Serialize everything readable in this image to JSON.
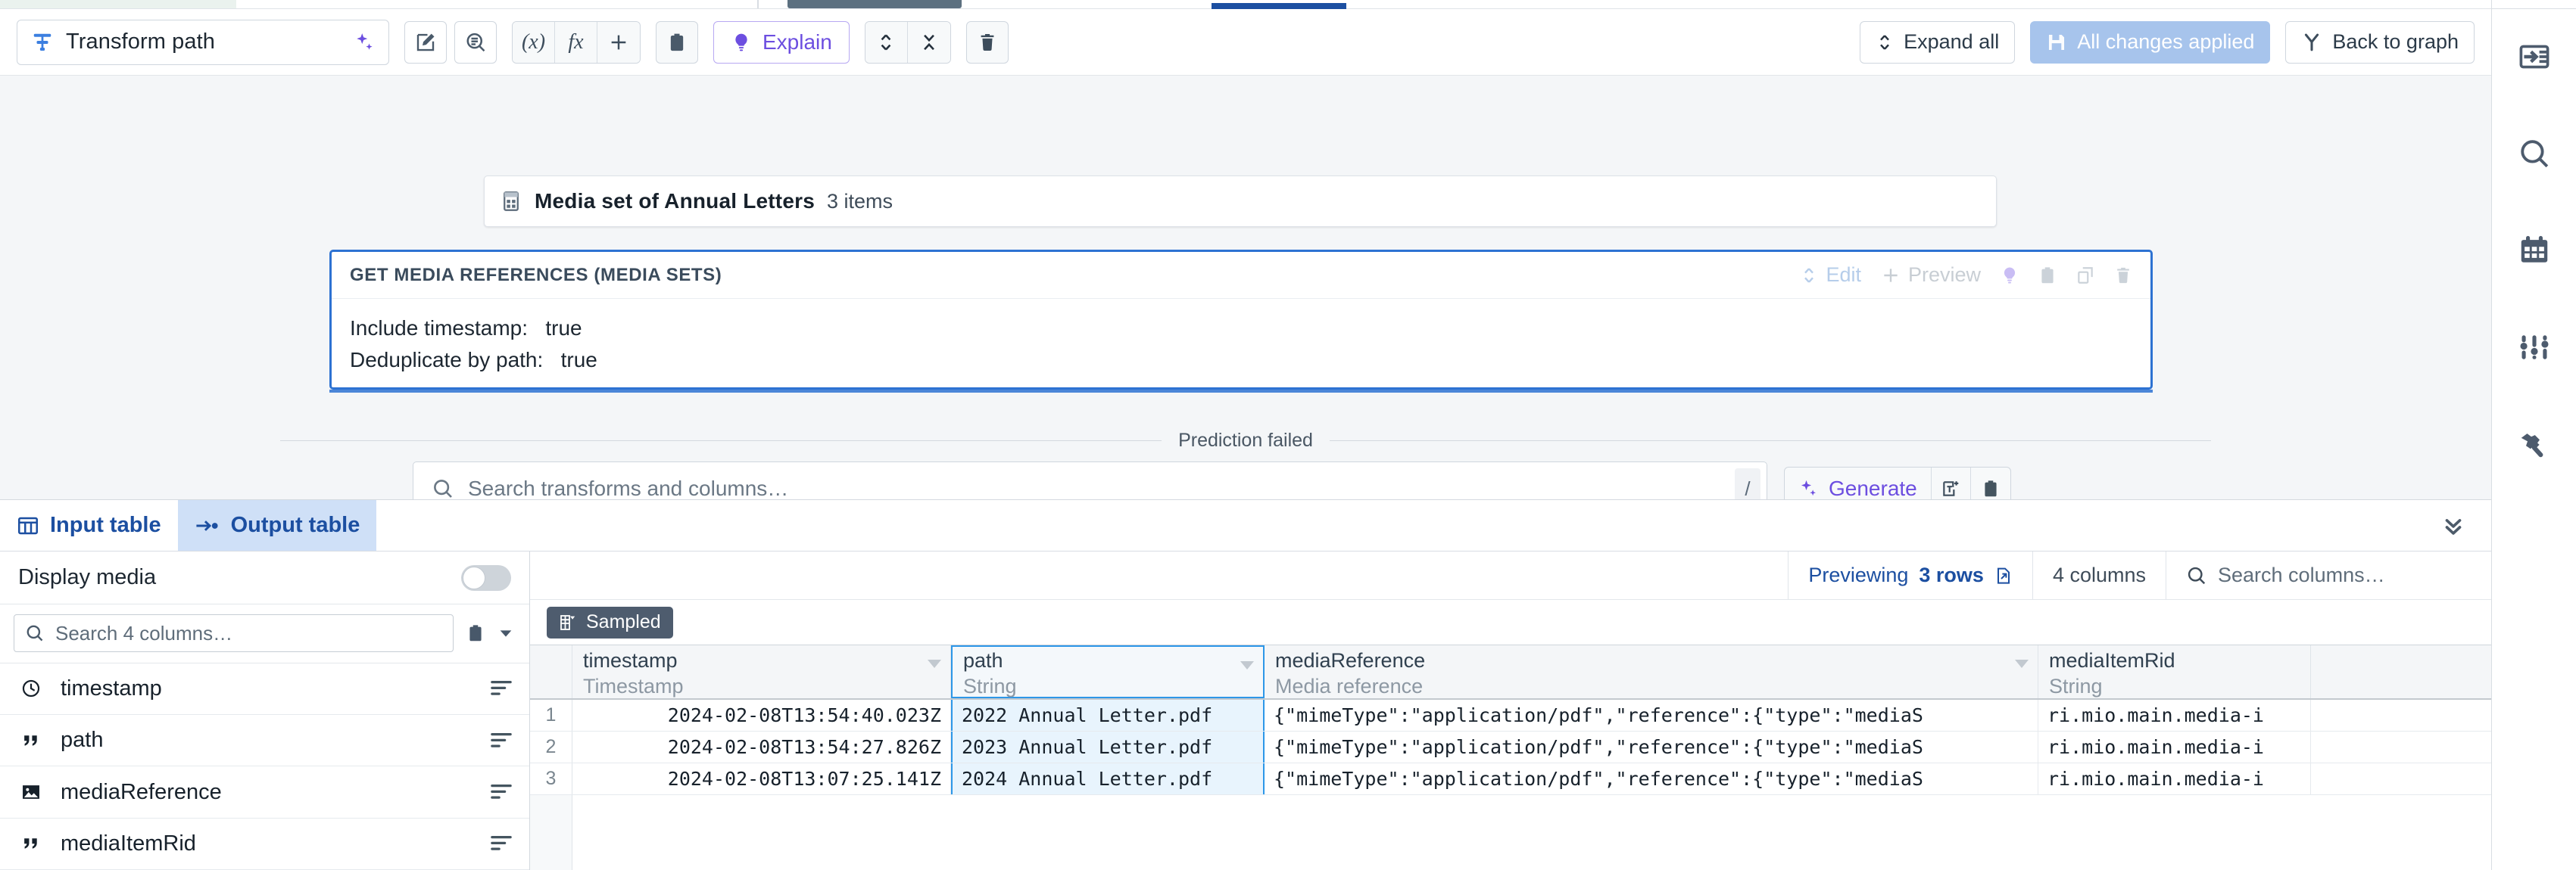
{
  "toolbar": {
    "transform_name": "Transform path",
    "sparkle_icon": "sparkles-icon",
    "buttons": [
      {
        "name": "edit-expression-button",
        "icon": "pencil-square-icon"
      },
      {
        "name": "search-transform-button",
        "icon": "zoom-document-icon"
      },
      {
        "name": "variable-button",
        "icon": "(x)"
      },
      {
        "name": "function-button",
        "icon": "fx"
      },
      {
        "name": "add-button",
        "icon": "plus-icon"
      },
      {
        "name": "paste-button",
        "icon": "clipboard-icon"
      }
    ],
    "explain_label": "Explain",
    "explain_icon": "lightbulb-icon",
    "move_icon": "expand-collapse-icon",
    "collapse_icon": "collapse-icon",
    "delete_icon": "trash-icon",
    "expand_all_label": "Expand all",
    "expand_all_icon": "chevron-up-down-icon",
    "changes_applied_label": "All changes applied",
    "changes_applied_icon": "save-icon",
    "back_to_graph_label": "Back to graph",
    "back_to_graph_icon": "branch-icon"
  },
  "canvas": {
    "mediaset": {
      "icon": "media-set-icon",
      "title": "Media set of Annual Letters",
      "count": "3 items"
    },
    "transform_card": {
      "title": "GET MEDIA REFERENCES (MEDIA SETS)",
      "params": [
        {
          "label": "Include timestamp:",
          "value": "true"
        },
        {
          "label": "Deduplicate by path:",
          "value": "true"
        }
      ],
      "actions": {
        "edit_label": "Edit",
        "edit_icon": "chevron-up-down-icon",
        "preview_label": "Preview",
        "preview_icon": "plus-icon",
        "bulb_icon": "lightbulb-icon",
        "clipboard_icon": "clipboard-icon",
        "duplicate_icon": "duplicate-icon",
        "trash_icon": "trash-icon"
      }
    },
    "prediction_status": "Prediction failed",
    "search": {
      "icon": "search-icon",
      "placeholder": "Search transforms and columns…",
      "shortcut": "/"
    },
    "generate": {
      "label": "Generate",
      "icon": "sparkles-icon",
      "text_icon": "add-text-icon",
      "clipboard_icon": "clipboard-icon"
    }
  },
  "bottom": {
    "tabs": [
      {
        "label": "Input table",
        "icon": "table-icon",
        "active": false
      },
      {
        "label": "Output table",
        "icon": "output-arrow-icon",
        "active": true
      }
    ],
    "collapse_icon": "double-chevron-down-icon",
    "left_pane": {
      "display_media_label": "Display media",
      "display_media_on": false,
      "search_placeholder": "Search 4 columns…",
      "search_icon": "search-icon",
      "clipboard_icon": "clipboard-icon",
      "caret_icon": "caret-down-icon",
      "columns": [
        {
          "name": "timestamp",
          "icon": "clock-icon",
          "right_icon": "align-left-icon"
        },
        {
          "name": "path",
          "icon": "quote-icon",
          "right_icon": "align-left-icon"
        },
        {
          "name": "mediaReference",
          "icon": "image-icon",
          "right_icon": "align-left-icon"
        },
        {
          "name": "mediaItemRid",
          "icon": "quote-icon",
          "right_icon": "align-left-icon"
        }
      ]
    },
    "table_header": {
      "previewing_prefix": "Previewing",
      "previewing_rows": "3 rows",
      "previewing_icon": "open-external-icon",
      "columns_count": "4 columns",
      "search_icon": "search-icon",
      "search_placeholder": "Search columns…"
    },
    "sampled_badge": {
      "label": "Sampled",
      "icon": "sample-table-icon"
    },
    "table": {
      "columns": [
        {
          "name": "timestamp",
          "type": "Timestamp",
          "selected": false,
          "align": "right"
        },
        {
          "name": "path",
          "type": "String",
          "selected": true,
          "align": "left"
        },
        {
          "name": "mediaReference",
          "type": "Media reference",
          "selected": false,
          "align": "left"
        },
        {
          "name": "mediaItemRid",
          "type": "String",
          "selected": false,
          "align": "left"
        }
      ],
      "rows": [
        {
          "index": "1",
          "timestamp": "2024-02-08T13:54:40.023Z",
          "path": "2022 Annual Letter.pdf",
          "mediaReference": "{\"mimeType\":\"application/pdf\",\"reference\":{\"type\":\"mediaS",
          "mediaItemRid": "ri.mio.main.media-i"
        },
        {
          "index": "2",
          "timestamp": "2024-02-08T13:54:27.826Z",
          "path": "2023 Annual Letter.pdf",
          "mediaReference": "{\"mimeType\":\"application/pdf\",\"reference\":{\"type\":\"mediaS",
          "mediaItemRid": "ri.mio.main.media-i"
        },
        {
          "index": "3",
          "timestamp": "2024-02-08T13:07:25.141Z",
          "path": "2024 Annual Letter.pdf",
          "mediaReference": "{\"mimeType\":\"application/pdf\",\"reference\":{\"type\":\"mediaS",
          "mediaItemRid": "ri.mio.main.media-i"
        }
      ]
    }
  },
  "rail": {
    "icons": [
      {
        "name": "panel-expand-icon"
      },
      {
        "name": "search-icon"
      },
      {
        "name": "calendar-icon"
      },
      {
        "name": "sliders-icon"
      },
      {
        "name": "hammer-icon"
      }
    ]
  },
  "colors": {
    "accent_blue": "#2d72d2",
    "tab_blue": "#1c4fa1",
    "purple": "#6c4ee0",
    "selection_blue": "#2d97e8",
    "applied_blue": "#a7c4ec"
  }
}
